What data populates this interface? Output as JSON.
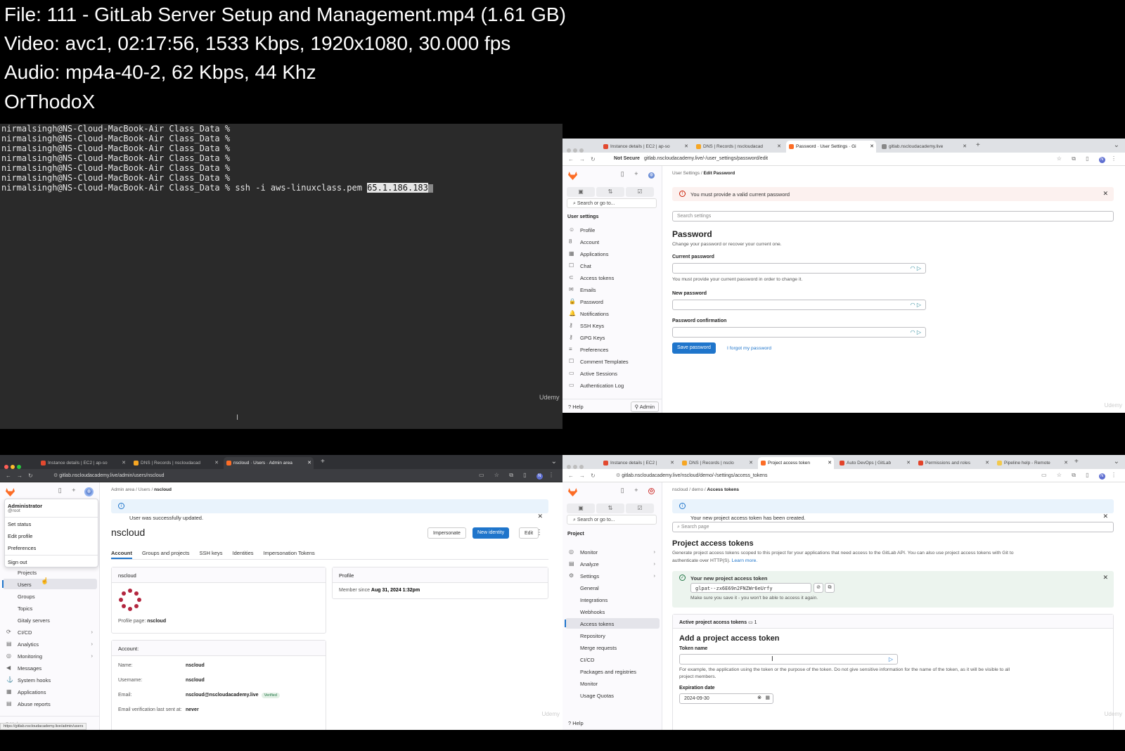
{
  "file_info": [
    "File: 111 - GitLab Server Setup and Management.mp4 (1.61 GB)",
    "Video: avc1, 02:17:56, 1533 Kbps, 1920x1080, 30.000 fps",
    "Audio: mp4a-40-2, 62 Kbps, 44 Khz",
    "OrThodoX"
  ],
  "terminal": {
    "prompt_lines": [
      "nirmalsingh@NS-Cloud-MacBook-Air Class_Data %",
      "nirmalsingh@NS-Cloud-MacBook-Air Class_Data %",
      "nirmalsingh@NS-Cloud-MacBook-Air Class_Data %",
      "nirmalsingh@NS-Cloud-MacBook-Air Class_Data %",
      "nirmalsingh@NS-Cloud-MacBook-Air Class_Data %",
      "nirmalsingh@NS-Cloud-MacBook-Air Class_Data %"
    ],
    "command_prefix": "nirmalsingh@NS-Cloud-MacBook-Air Class_Data % ssh -i aws-linuxclass.pem ",
    "selected_ip": "65.1.186.183",
    "watermark": "Udemy"
  },
  "win_password": {
    "tabs": [
      "Instance details | EC2 | ap-so",
      "DNS | Records | nscloudacad",
      "Password · User Settings · Gi",
      "gitlab.nscloudacademy.live"
    ],
    "not_secure": "Not Secure",
    "url": "gitlab.nscloudacademy.live/-/user_settings/password/edit",
    "search": "Search or go to...",
    "section": "User settings",
    "nav": [
      {
        "icon": "☺",
        "label": "Profile"
      },
      {
        "icon": "8",
        "label": "Account"
      },
      {
        "icon": "▦",
        "label": "Applications"
      },
      {
        "icon": "☐",
        "label": "Chat"
      },
      {
        "icon": "⊂",
        "label": "Access tokens"
      },
      {
        "icon": "✉",
        "label": "Emails"
      },
      {
        "icon": "🔒",
        "label": "Password"
      },
      {
        "icon": "🔔",
        "label": "Notifications"
      },
      {
        "icon": "⚷",
        "label": "SSH Keys"
      },
      {
        "icon": "⚷",
        "label": "GPG Keys"
      },
      {
        "icon": "≡",
        "label": "Preferences"
      },
      {
        "icon": "☐",
        "label": "Comment Templates"
      },
      {
        "icon": "▭",
        "label": "Active Sessions"
      },
      {
        "icon": "▭",
        "label": "Authentication Log"
      }
    ],
    "help": "Help",
    "admin": "Admin",
    "breadcrumb": [
      "User Settings",
      "Edit Password"
    ],
    "alert": "You must provide a valid current password",
    "search_settings": "Search settings",
    "title": "Password",
    "subtitle": "Change your password or recover your current one.",
    "current_label": "Current password",
    "current_help": "You must provide your current password in order to change it.",
    "new_label": "New password",
    "confirm_label": "Password confirmation",
    "save": "Save password",
    "forgot": "I forgot my password",
    "watermark": "Udemy"
  },
  "win_admin": {
    "tabs": [
      "Instance details | EC2 | ap-so",
      "DNS | Records | nscloudacad",
      "nscloud · Users · Admin area"
    ],
    "url": "gitlab.nscloudacademy.live/admin/users/nscloud",
    "dropdown": {
      "name": "Administrator",
      "handle": "@root",
      "items": [
        "Set status",
        "Edit profile",
        "Preferences",
        "Sign out"
      ]
    },
    "nav": [
      {
        "label": "Projects",
        "sub": true
      },
      {
        "label": "Users",
        "sub": true,
        "active": true
      },
      {
        "label": "Groups",
        "sub": true
      },
      {
        "label": "Topics",
        "sub": true
      },
      {
        "label": "Gitaly servers",
        "sub": true
      },
      {
        "icon": "⟳",
        "label": "CI/CD",
        "chev": true
      },
      {
        "icon": "▤",
        "label": "Analytics",
        "chev": true
      },
      {
        "icon": "◎",
        "label": "Monitoring",
        "chev": true
      },
      {
        "icon": "◀",
        "label": "Messages"
      },
      {
        "icon": "⚓",
        "label": "System hooks"
      },
      {
        "icon": "▦",
        "label": "Applications"
      },
      {
        "icon": "▤",
        "label": "Abuse reports"
      }
    ],
    "breadcrumb": [
      "Admin area",
      "Users",
      "nscloud"
    ],
    "alert": "User was successfully updated.",
    "title": "nscloud",
    "buttons": [
      "Impersonate",
      "New identity",
      "Edit"
    ],
    "tabs_row": [
      "Account",
      "Groups and projects",
      "SSH keys",
      "Identities",
      "Impersonation Tokens"
    ],
    "profile_card": {
      "head": "nscloud",
      "page_label": "Profile page:",
      "page_value": "nscloud"
    },
    "profile_right": {
      "head": "Profile",
      "member_label": "Member since",
      "member_value": "Aug 31, 2024 1:32pm"
    },
    "account": {
      "head": "Account:",
      "rows": [
        {
          "k": "Name:",
          "v": "nscloud"
        },
        {
          "k": "Username:",
          "v": "nscloud"
        },
        {
          "k": "Email:",
          "v": "nscloud@nscloudacademy.live",
          "badge": "Verified"
        },
        {
          "k": "Email verification last sent at:",
          "v": "never"
        }
      ]
    },
    "status_url": "https://gitlab.nscloudacademy.live/admin/users",
    "watermark": "Udemy"
  },
  "win_tokens": {
    "tabs": [
      "Instance details | EC2 |",
      "DNS | Records | nsclo",
      "Project access token",
      "Auto DevOps | GitLab",
      "Permissions and roles",
      "Pipeline help - Remote"
    ],
    "url": "gitlab.nscloudacademy.live/nscloud/demo/-/settings/access_tokens",
    "search": "Search or go to...",
    "section": "Project",
    "nav": [
      {
        "icon": "◎",
        "label": "Monitor",
        "chev": true
      },
      {
        "icon": "▤",
        "label": "Analyze",
        "chev": true
      },
      {
        "icon": "⚙",
        "label": "Settings",
        "chev": true
      },
      {
        "label": "General",
        "sub": true
      },
      {
        "label": "Integrations",
        "sub": true
      },
      {
        "label": "Webhooks",
        "sub": true
      },
      {
        "label": "Access tokens",
        "sub": true,
        "active": true
      },
      {
        "label": "Repository",
        "sub": true
      },
      {
        "label": "Merge requests",
        "sub": true
      },
      {
        "label": "CI/CD",
        "sub": true
      },
      {
        "label": "Packages and registries",
        "sub": true
      },
      {
        "label": "Monitor",
        "sub": true
      },
      {
        "label": "Usage Quotas",
        "sub": true
      }
    ],
    "help": "Help",
    "breadcrumb": [
      "nscloud",
      "demo",
      "Access tokens"
    ],
    "alert": "Your new project access token has been created.",
    "search_page": "Search page",
    "title": "Project access tokens",
    "desc1": "Generate project access tokens scoped to this project for your applications that need access to the GitLab API. You can also use project access tokens with Git to",
    "desc2": "authenticate over HTTP(S).",
    "learn_more": "Learn more.",
    "new_token_head": "Your new project access token",
    "token_value": "glpat--zx6E69n2FNZWr6eUrfy",
    "token_note": "Make sure you save it - you won't be able to access it again.",
    "active_label": "Active project access tokens",
    "active_count": "1",
    "add_title": "Add a project access token",
    "token_name_label": "Token name",
    "token_name_help1": "For example, the application using the token or the purpose of the token. Do not give sensitive information for the name of the token, as it will be visible to all",
    "token_name_help2": "project members.",
    "expiration_label": "Expiration date",
    "expiration_value": "2024-09-30",
    "watermark": "Udemy"
  }
}
